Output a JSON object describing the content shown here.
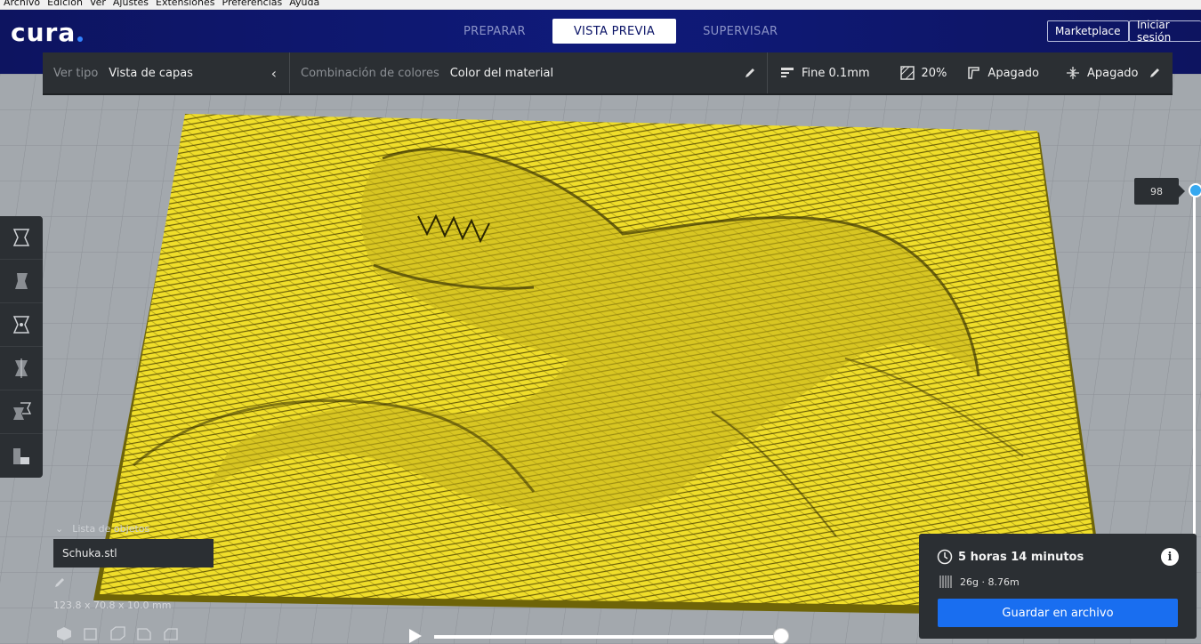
{
  "menu": [
    "Archivo",
    "Edición",
    "Ver",
    "Ajustes",
    "Extensiones",
    "Preferencias",
    "Ayuda"
  ],
  "header": {
    "logo": "cura",
    "tabs": [
      {
        "label": "PREPARAR",
        "active": false
      },
      {
        "label": "VISTA PREVIA",
        "active": true
      },
      {
        "label": "SUPERVISAR",
        "active": false
      }
    ],
    "marketplace_label": "Marketplace",
    "signin_label": "Iniciar sesión"
  },
  "settings_bar": {
    "view_type_label": "Ver tipo",
    "view_type_value": "Vista de capas",
    "color_scheme_label": "Combinación de colores",
    "color_scheme_value": "Color del material",
    "profile": "Fine 0.1mm",
    "infill": "20%",
    "support": "Apagado",
    "adhesion": "Apagado"
  },
  "layer_slider": {
    "current_layer": "98"
  },
  "object_list": {
    "header": "Lista de objetos",
    "object_name": "Schuka.stl",
    "dimensions": "123.8 x 70.8 x 10.0 mm"
  },
  "print_info": {
    "time": "5 horas 14 minutos",
    "material": "26g · 8.76m",
    "save_label": "Guardar en archivo"
  },
  "colors": {
    "header_bg": "#0f1a7a",
    "panel_bg": "#2b2f33",
    "accent_blue": "#196ef0",
    "model_yellow": "#f0de2a",
    "slider_handle": "#35a8f0"
  }
}
